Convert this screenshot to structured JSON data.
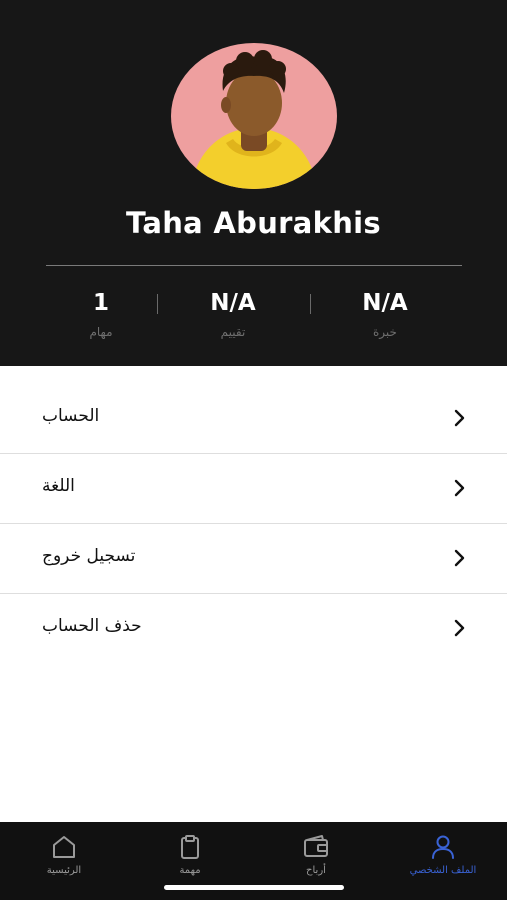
{
  "profile": {
    "name": "Taha Aburakhis",
    "avatar_icon": "person-avatar-illustration"
  },
  "stats": [
    {
      "value": "N/A",
      "label": "خبرة"
    },
    {
      "value": "N/A",
      "label": "تقييم"
    },
    {
      "value": "1",
      "label": "مهام"
    }
  ],
  "menu": {
    "items": [
      {
        "label": "الحساب",
        "icon": "chevron-right-icon"
      },
      {
        "label": "اللغة",
        "icon": "chevron-right-icon"
      },
      {
        "label": "تسجيل خروج",
        "icon": "chevron-right-icon"
      },
      {
        "label": "حذف الحساب",
        "icon": "chevron-right-icon"
      }
    ]
  },
  "tabbar": {
    "tabs": [
      {
        "label": "الرئيسية",
        "icon": "home-icon",
        "active": false
      },
      {
        "label": "مهمة",
        "icon": "clipboard-icon",
        "active": false
      },
      {
        "label": "أرباح",
        "icon": "wallet-icon",
        "active": false
      },
      {
        "label": "الملف الشخصي",
        "icon": "user-icon",
        "active": true
      }
    ]
  },
  "colors": {
    "header_bg": "#171717",
    "accent": "#3a63d6",
    "avatar_bg": "#ee9f9f",
    "hoodie": "#f3cf2c"
  }
}
